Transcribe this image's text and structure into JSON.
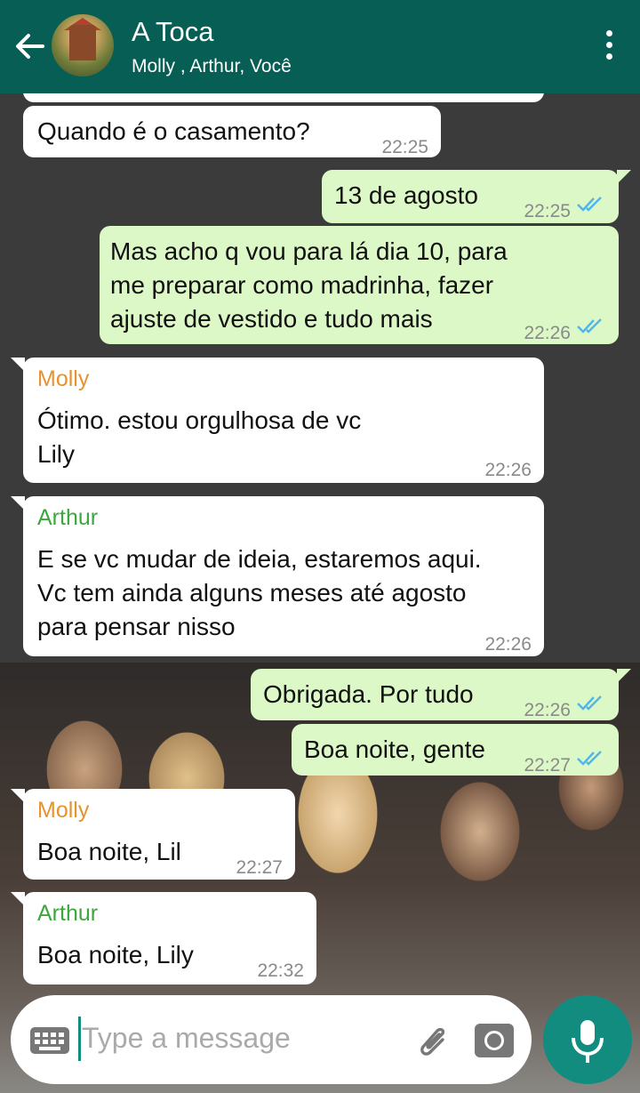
{
  "header": {
    "title": "A Toca",
    "subtitle": "Molly , Arthur, Você",
    "colors": {
      "bar": "#075e54"
    }
  },
  "messages": [
    {
      "dir": "in",
      "text": "Quando é o casamento?",
      "time": "22:25"
    },
    {
      "dir": "out",
      "text": "13 de agosto",
      "time": "22:25"
    },
    {
      "dir": "out",
      "lines": [
        "Mas acho q vou para lá dia 10, para",
        "me preparar como madrinha, fazer",
        "ajuste de vestido e tudo mais"
      ],
      "time": "22:26"
    },
    {
      "dir": "in",
      "sender": "Molly",
      "lines": [
        "Ótimo. estou orgulhosa de vc",
        "Lily"
      ],
      "time": "22:26"
    },
    {
      "dir": "in",
      "sender": "Arthur",
      "lines": [
        "E se vc mudar de ideia, estaremos aqui.",
        "Vc tem ainda alguns meses até agosto",
        "para pensar nisso"
      ],
      "time": "22:26"
    },
    {
      "dir": "out",
      "text": "Obrigada. Por tudo",
      "time": "22:26"
    },
    {
      "dir": "out",
      "text": "Boa noite, gente",
      "time": "22:27"
    },
    {
      "dir": "in",
      "sender": "Molly",
      "text": "Boa noite, Lil",
      "time": "22:27"
    },
    {
      "dir": "in",
      "sender": "Arthur",
      "text": "Boa noite, Lily",
      "time": "22:32"
    }
  ],
  "sender_colors": {
    "Molly": "#e8922e",
    "Arthur": "#3aa83a"
  },
  "input": {
    "placeholder": "Type a message"
  },
  "icons": [
    "back-arrow-icon",
    "more-vert-icon",
    "keyboard-icon",
    "attach-icon",
    "camera-icon",
    "mic-icon",
    "double-check-icon"
  ]
}
